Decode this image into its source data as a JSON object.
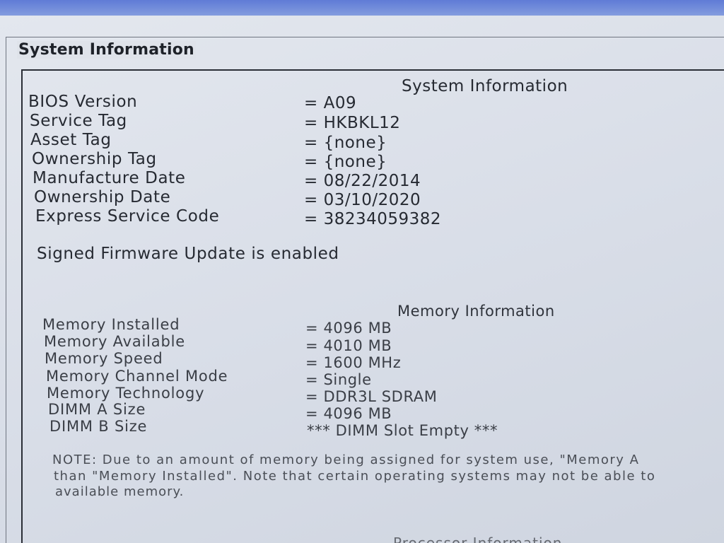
{
  "group_title": "System Information",
  "system": {
    "heading": "System Information",
    "rows": [
      {
        "label": "BIOS Version",
        "value": "= A09"
      },
      {
        "label": "Service Tag",
        "value": "= HKBKL12"
      },
      {
        "label": "Asset Tag",
        "value": "= {none}"
      },
      {
        "label": "Ownership Tag",
        "value": "= {none}"
      },
      {
        "label": "Manufacture Date",
        "value": "= 08/22/2014"
      },
      {
        "label": "Ownership Date",
        "value": "= 03/10/2020"
      },
      {
        "label": "Express Service Code",
        "value": "= 38234059382"
      }
    ],
    "firmware_note": "Signed Firmware Update is enabled"
  },
  "memory": {
    "heading": "Memory Information",
    "rows": [
      {
        "label": "Memory Installed",
        "value": "= 4096 MB"
      },
      {
        "label": "Memory Available",
        "value": "= 4010 MB"
      },
      {
        "label": "Memory Speed",
        "value": "= 1600 MHz"
      },
      {
        "label": "Memory Channel Mode",
        "value": "= Single"
      },
      {
        "label": "Memory Technology",
        "value": "= DDR3L SDRAM"
      },
      {
        "label": "DIMM A Size",
        "value": "= 4096 MB"
      },
      {
        "label": "DIMM B Size",
        "value": "*** DIMM Slot Empty ***"
      }
    ],
    "note_lines": [
      "NOTE: Due to an amount of memory being assigned for system use, \"Memory A",
      "than \"Memory Installed\". Note that certain operating systems may not be able to",
      "available memory."
    ]
  },
  "processor_heading_partial": "Processor Information"
}
